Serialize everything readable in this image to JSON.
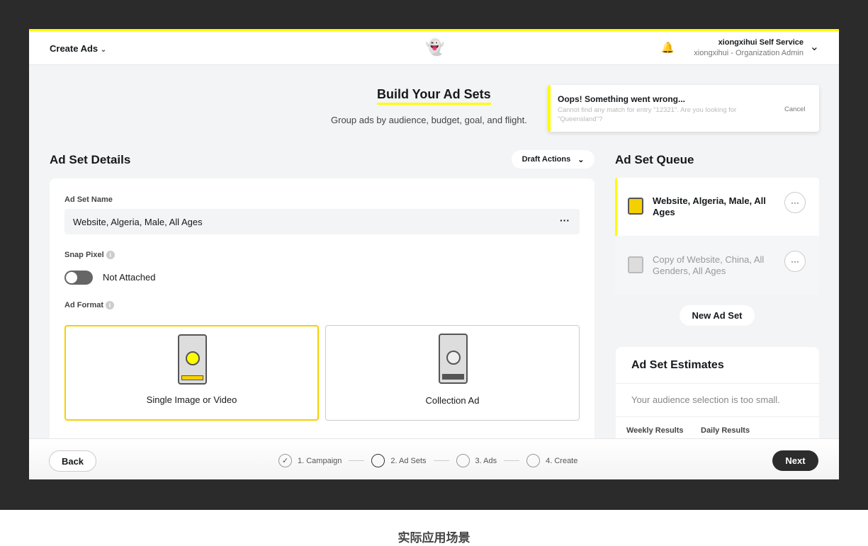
{
  "header": {
    "menu_label": "Create Ads",
    "account_name": "xiongxihui Self Service",
    "account_role": "xiongxihui - Organization Admin"
  },
  "page": {
    "title": "Build Your Ad Sets",
    "subtitle": "Group ads by audience, budget, goal, and flight."
  },
  "toast": {
    "title": "Oops! Something went wrong...",
    "message": "Cannot find any match for entry \"12321\". Are you looking for \"Queensland\"?",
    "cancel": "Cancel",
    "accent": "#fffc00"
  },
  "details": {
    "heading": "Ad Set Details",
    "draft_actions": "Draft Actions",
    "name_label": "Ad Set Name",
    "name_value": "Website, Algeria, Male, All Ages",
    "pixel_label": "Snap Pixel",
    "pixel_state": "Not Attached",
    "format_label": "Ad Format",
    "formats": [
      {
        "label": "Single Image or Video",
        "selected": true
      },
      {
        "label": "Collection Ad",
        "selected": false
      }
    ]
  },
  "queue": {
    "heading": "Ad Set Queue",
    "items": [
      {
        "label": "Website, Algeria, Male, All Ages",
        "active": true
      },
      {
        "label": "Copy of Website, China, All Genders, All Ages",
        "active": false
      }
    ],
    "new_button": "New Ad Set"
  },
  "estimates": {
    "heading": "Ad Set Estimates",
    "message": "Your audience selection is too small.",
    "tabs": [
      "Weekly Results",
      "Daily Results"
    ]
  },
  "footer": {
    "back": "Back",
    "next": "Next",
    "steps": [
      {
        "label": "1. Campaign",
        "done": true
      },
      {
        "label": "2. Ad Sets",
        "current": true
      },
      {
        "label": "3. Ads"
      },
      {
        "label": "4. Create"
      }
    ]
  },
  "caption": "实际应用场景"
}
